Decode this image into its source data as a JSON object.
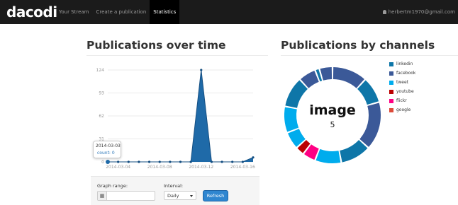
{
  "app": {
    "brand": "dacodi",
    "user_email": "herbertm1970@gmail.com"
  },
  "nav": [
    {
      "label": "Your Stream",
      "active": false
    },
    {
      "label": "Create a publication",
      "active": false
    },
    {
      "label": "Statistics",
      "active": true
    }
  ],
  "sections": {
    "left_title": "Publications over time",
    "right_title": "Publications by channels"
  },
  "tooltip": {
    "date": "2014-03-03",
    "count": "count: 0"
  },
  "form": {
    "graph_range_label": "Graph range:",
    "interval_label": "Interval:",
    "interval_value": "Daily",
    "refresh_label": "Refresh"
  },
  "donut_center": {
    "title": "image",
    "value": "5"
  },
  "legend": [
    {
      "name": "linkedin",
      "color": "#0e76a8"
    },
    {
      "name": "facebook",
      "color": "#3b5998"
    },
    {
      "name": "tweet",
      "color": "#00aced"
    },
    {
      "name": "youtube",
      "color": "#bb0000"
    },
    {
      "name": "flickr",
      "color": "#ff0084"
    },
    {
      "name": "google",
      "color": "#dd4b39"
    }
  ],
  "chart_data": [
    {
      "type": "area",
      "title": "Publications over time",
      "x": [
        "2014-03-03",
        "2014-03-04",
        "2014-03-05",
        "2014-03-06",
        "2014-03-07",
        "2014-03-08",
        "2014-03-09",
        "2014-03-10",
        "2014-03-11",
        "2014-03-12",
        "2014-03-13",
        "2014-03-14",
        "2014-03-15",
        "2014-03-16",
        "2014-03-17"
      ],
      "series": [
        {
          "values": [
            0,
            0,
            0,
            0,
            0,
            0,
            0,
            0,
            0,
            124,
            0,
            0,
            0,
            0,
            6
          ]
        }
      ],
      "x_tick_labels": [
        "2014-03-04",
        "2014-03-08",
        "2014-03-12",
        "2014-03-16"
      ],
      "y_ticks": [
        0,
        31,
        62,
        93,
        124
      ],
      "ylim": [
        0,
        124
      ],
      "grid": true,
      "color": "#1f6aa8"
    },
    {
      "type": "pie",
      "title": "Publications by channels",
      "labels": [
        "facebook",
        "linkedin",
        "facebook",
        "linkedin",
        "tweet",
        "flickr",
        "youtube",
        "tweet",
        "tweet",
        "linkedin",
        "facebook",
        "linkedin",
        "facebook"
      ],
      "values": [
        8,
        6,
        11,
        7,
        6,
        3,
        2,
        4,
        6,
        7,
        4,
        1,
        3
      ],
      "colors": [
        "#3b5998",
        "#0e76a8",
        "#3b5998",
        "#0e76a8",
        "#00aced",
        "#ff0084",
        "#bb0000",
        "#00aced",
        "#00aced",
        "#0e76a8",
        "#3b5998",
        "#0e76a8",
        "#3b5998"
      ],
      "legend": "right"
    }
  ]
}
